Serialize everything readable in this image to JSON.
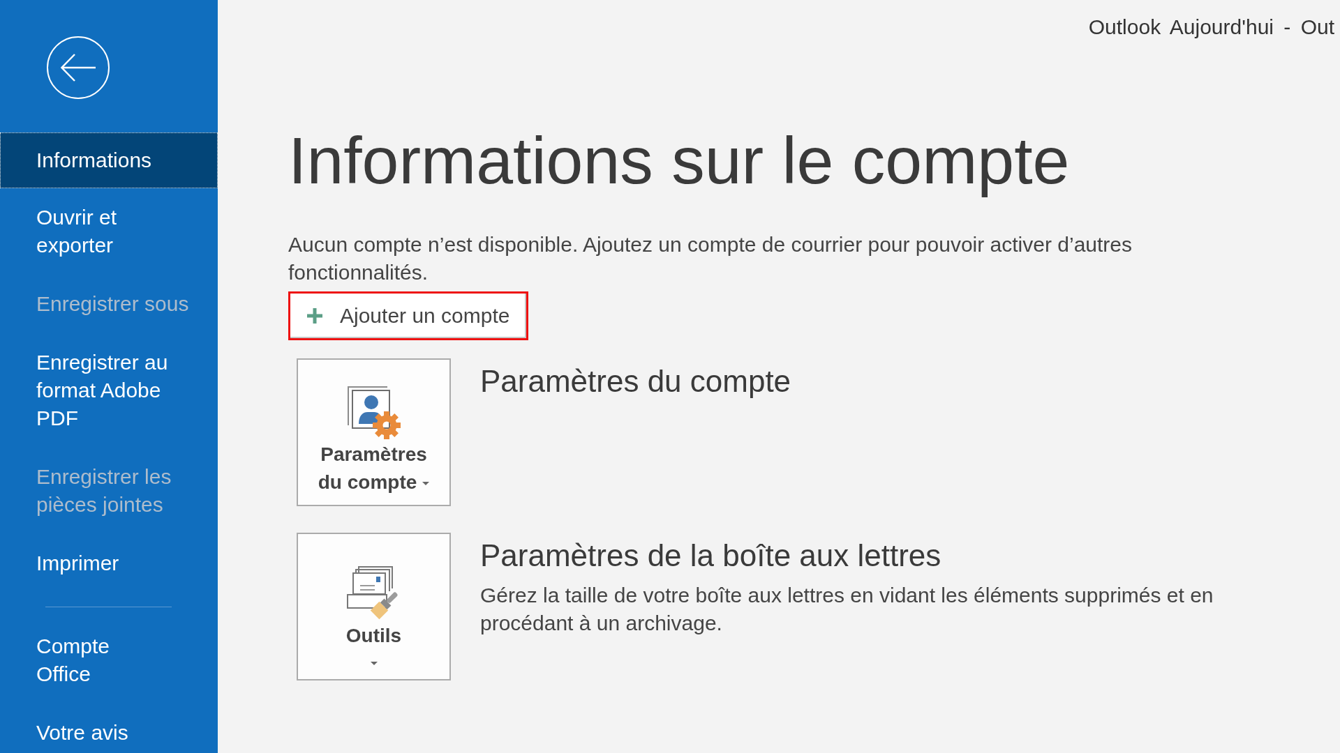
{
  "window": {
    "title": "Outlook Aujourd'hui - Out"
  },
  "sidebar": {
    "groups": [
      {
        "items": [
          {
            "label": "Informations",
            "selected": true,
            "disabled": false
          },
          {
            "label": "Ouvrir et\nexporter",
            "selected": false,
            "disabled": false
          },
          {
            "label": "Enregistrer sous",
            "selected": false,
            "disabled": true
          },
          {
            "label": "Enregistrer au\nformat Adobe\nPDF",
            "selected": false,
            "disabled": false
          },
          {
            "label": "Enregistrer les\npièces jointes",
            "selected": false,
            "disabled": true
          },
          {
            "label": "Imprimer",
            "selected": false,
            "disabled": false
          }
        ]
      },
      {
        "items": [
          {
            "label": "Compte\nOffice",
            "selected": false,
            "disabled": false
          },
          {
            "label": "Votre avis",
            "selected": false,
            "disabled": false
          }
        ]
      }
    ]
  },
  "page": {
    "title": "Informations sur le compte",
    "message": "Aucun compte n’est disponible. Ajoutez un compte de courrier pour pouvoir activer d’autres fonctionnalités.",
    "add_account_button": {
      "label": "Ajouter un compte",
      "highlighted": true
    }
  },
  "sections": [
    {
      "tile": {
        "kind": "account",
        "label": "Paramètres du compte",
        "dropdown": true
      },
      "heading": "Paramètres du compte"
    },
    {
      "tile": {
        "kind": "tools",
        "label": "Outils",
        "dropdown": true
      },
      "heading": "Paramètres de la boîte aux lettres",
      "description": "Gérez la taille de votre boîte aux lettres en vidant les éléments supprimés et en procédant à un archivage."
    }
  ]
}
